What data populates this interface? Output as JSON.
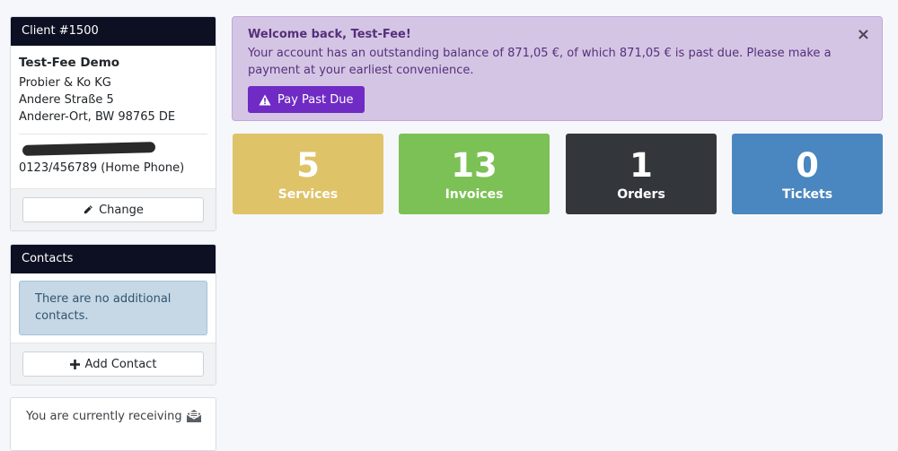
{
  "client_panel": {
    "header": "Client #1500",
    "name": "Test-Fee Demo",
    "address": [
      "Probier & Ko KG",
      "Andere Straße 5",
      "Anderer-Ort, BW 98765 DE"
    ],
    "phone": "0123/456789 (Home Phone)",
    "change_label": "Change",
    "change_icon": "pencil-icon"
  },
  "contacts_panel": {
    "header": "Contacts",
    "empty_message": "There are no additional contacts.",
    "add_label": "Add Contact",
    "add_icon": "plus-icon"
  },
  "email_panel": {
    "text": "You are currently receiving",
    "icon": "envelope-open-icon"
  },
  "alert": {
    "title": "Welcome back, Test-Fee!",
    "message": "Your account has an outstanding balance of 871,05 €, of which 871,05 € is past due. Please make a payment at your earliest convenience.",
    "close_label": "×",
    "button_label": "Pay Past Due",
    "button_icon": "warning-triangle-icon",
    "colors": {
      "background": "#d5c5e5",
      "text": "#54307a",
      "button": "#6f2bc4"
    }
  },
  "stats": [
    {
      "count": "5",
      "label": "Services",
      "color": "#dfc368"
    },
    {
      "count": "13",
      "label": "Invoices",
      "color": "#7cc155"
    },
    {
      "count": "1",
      "label": "Orders",
      "color": "#33373c"
    },
    {
      "count": "0",
      "label": "Tickets",
      "color": "#4a86bf"
    }
  ]
}
